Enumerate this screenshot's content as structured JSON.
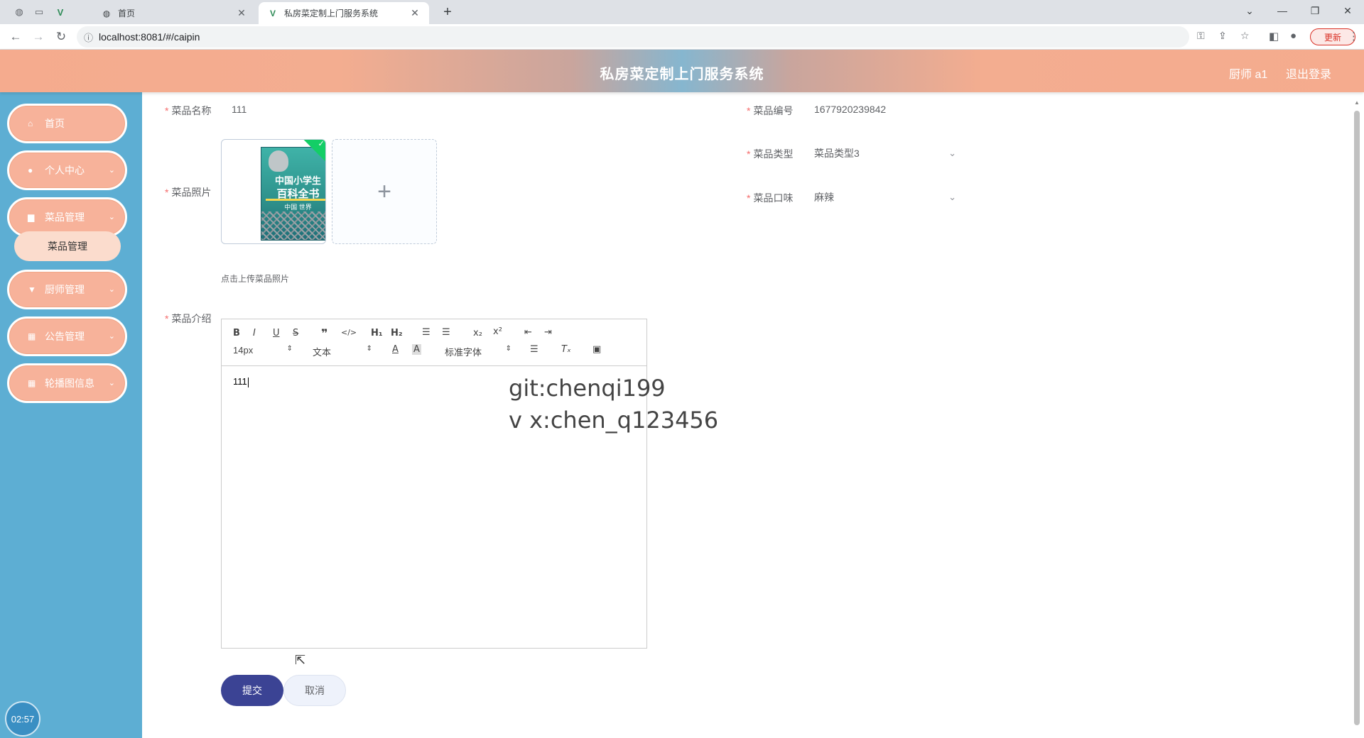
{
  "browser": {
    "tabs": [
      {
        "title": "首页",
        "icon": "globe-icon"
      },
      {
        "title": "私房菜定制上门服务系统",
        "icon": "vue-logo-icon"
      }
    ],
    "url": "localhost:8081/#/caipin",
    "update_label": "更新"
  },
  "header": {
    "title": "私房菜定制上门服务系统",
    "user": "厨师 a1",
    "logout": "退出登录"
  },
  "sidebar": {
    "items": [
      {
        "label": "首页",
        "icon": "home-icon"
      },
      {
        "label": "个人中心",
        "icon": "user-icon"
      },
      {
        "label": "菜品管理",
        "icon": "document-icon"
      },
      {
        "label": "厨师管理",
        "icon": "trophy-icon"
      },
      {
        "label": "公告管理",
        "icon": "grid-icon"
      },
      {
        "label": "轮播图信息",
        "icon": "grid-icon"
      }
    ],
    "submenu": {
      "label": "菜品管理"
    },
    "clock": "02:57"
  },
  "form": {
    "name": {
      "label": "菜品名称",
      "value": "111"
    },
    "code": {
      "label": "菜品编号",
      "value": "1677920239842"
    },
    "photo": {
      "label": "菜品照片",
      "tip": "点击上传菜品照片",
      "book_line1": "中国小学生",
      "book_line2": "百科全书",
      "book_line3": "中国  世界"
    },
    "type": {
      "label": "菜品类型",
      "value": "菜品类型3"
    },
    "flavor": {
      "label": "菜品口味",
      "value": "麻辣"
    },
    "intro": {
      "label": "菜品介绍",
      "value": "111"
    }
  },
  "editor": {
    "font_size": "14px",
    "format": "文本",
    "font": "标准字体"
  },
  "watermark": {
    "line1": "git:chenqi199",
    "line2": "v x:chen_q123456"
  },
  "buttons": {
    "submit": "提交",
    "cancel": "取消"
  }
}
